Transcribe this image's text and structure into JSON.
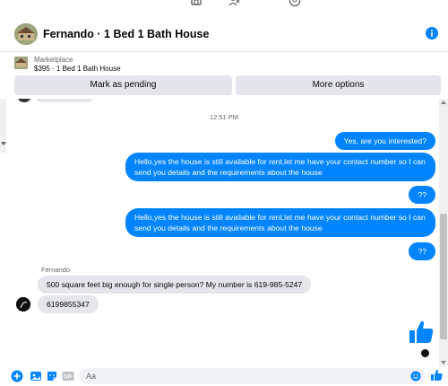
{
  "nav": {
    "icons": [
      "marketplace-icon",
      "people-icon",
      "groups-icon"
    ]
  },
  "header": {
    "title": "Fernando · 1 Bed 1 Bath House",
    "info_icon": "info-icon"
  },
  "listing": {
    "label": "Marketplace",
    "description": "$395 · 1 Bed 1 Bath House"
  },
  "actions": {
    "mark_pending": "Mark as pending",
    "more_options": "More options"
  },
  "chat": {
    "timestamp": "12:51 PM",
    "sender_name": "Fernando",
    "messages": [
      {
        "from": "me",
        "text": "Yes, are you interested?"
      },
      {
        "from": "me",
        "text": "Hello,yes the house is still available for rent,let me have your contact number so I can send you details and the requirements about the house"
      },
      {
        "from": "me",
        "text": "??"
      },
      {
        "from": "me",
        "text": "Hello,yes the house is still available for rent,let me have your contact number so I can send you details and the requirements about the house"
      },
      {
        "from": "me",
        "text": "??"
      },
      {
        "from": "them",
        "text": "500 square feet big enough for single person? My number is 619-985-5247"
      },
      {
        "from": "them",
        "text": "6199855347"
      }
    ]
  },
  "composer": {
    "placeholder": "Aa",
    "value": ""
  },
  "colors": {
    "accent": "#0084ff",
    "incoming_bubble": "#e4e6eb",
    "button_bg": "#e4e6eb",
    "secondary_text": "#65676b"
  }
}
